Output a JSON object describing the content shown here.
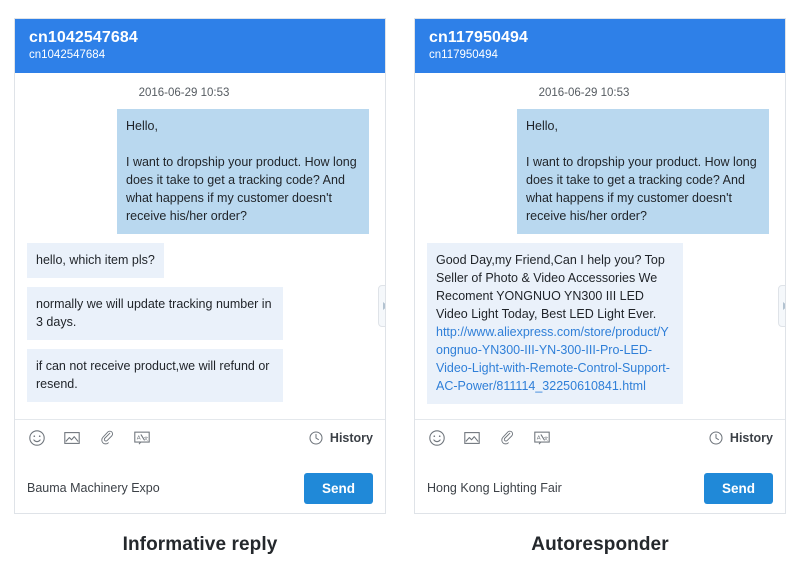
{
  "panels": [
    {
      "caption": "Informative reply",
      "header": {
        "title": "cn1042547684",
        "subtitle": "cn1042547684"
      },
      "timestamp": "2016-06-29 10:53",
      "messages": [
        {
          "direction": "incoming",
          "text": "Hello,\n\nI want to dropship your product. How long does it take to get a tracking code? And what happens if my customer doesn't receive his/her order?"
        },
        {
          "direction": "outgoing",
          "text": "hello, which item pls?"
        },
        {
          "direction": "outgoing",
          "text": "normally we will update tracking number in 3 days."
        },
        {
          "direction": "outgoing",
          "text": "if can not receive product,we will refund or resend."
        }
      ],
      "toolbar": {
        "icons": [
          "emoji-icon",
          "image-icon",
          "attachment-icon",
          "translate-icon"
        ],
        "history_label": "History"
      },
      "compose": {
        "value": "Bauma Machinery Expo",
        "placeholder": "",
        "send_label": "Send"
      }
    },
    {
      "caption": "Autoresponder",
      "header": {
        "title": "cn117950494",
        "subtitle": "cn117950494"
      },
      "timestamp": "2016-06-29 10:53",
      "messages": [
        {
          "direction": "incoming",
          "text": "Hello,\n\nI want to dropship your product. How long does it take to get a tracking code? And what happens if my customer doesn't receive his/her order?"
        },
        {
          "direction": "outgoing",
          "text": "Good Day,my Friend,Can I help you? Top Seller of Photo & Video Accessories We Recoment YONGNUO YN300 III LED Video Light Today, Best LED Light Ever. ",
          "link": "http://www.aliexpress.com/store/product/Yongnuo-YN300-III-YN-300-III-Pro-LED-Video-Light-with-Remote-Control-Support-AC-Power/811114_32250610841.html"
        }
      ],
      "toolbar": {
        "icons": [
          "emoji-icon",
          "image-icon",
          "attachment-icon",
          "translate-icon"
        ],
        "history_label": "History"
      },
      "compose": {
        "value": "Hong Kong Lighting Fair",
        "placeholder": "",
        "send_label": "Send"
      }
    }
  ],
  "colors": {
    "header_blue": "#2e80e8",
    "send_blue": "#2089d8",
    "incoming_bubble": "#b9d8ef",
    "outgoing_bubble": "#eaf1fa",
    "link_blue": "#2f7fd8"
  }
}
